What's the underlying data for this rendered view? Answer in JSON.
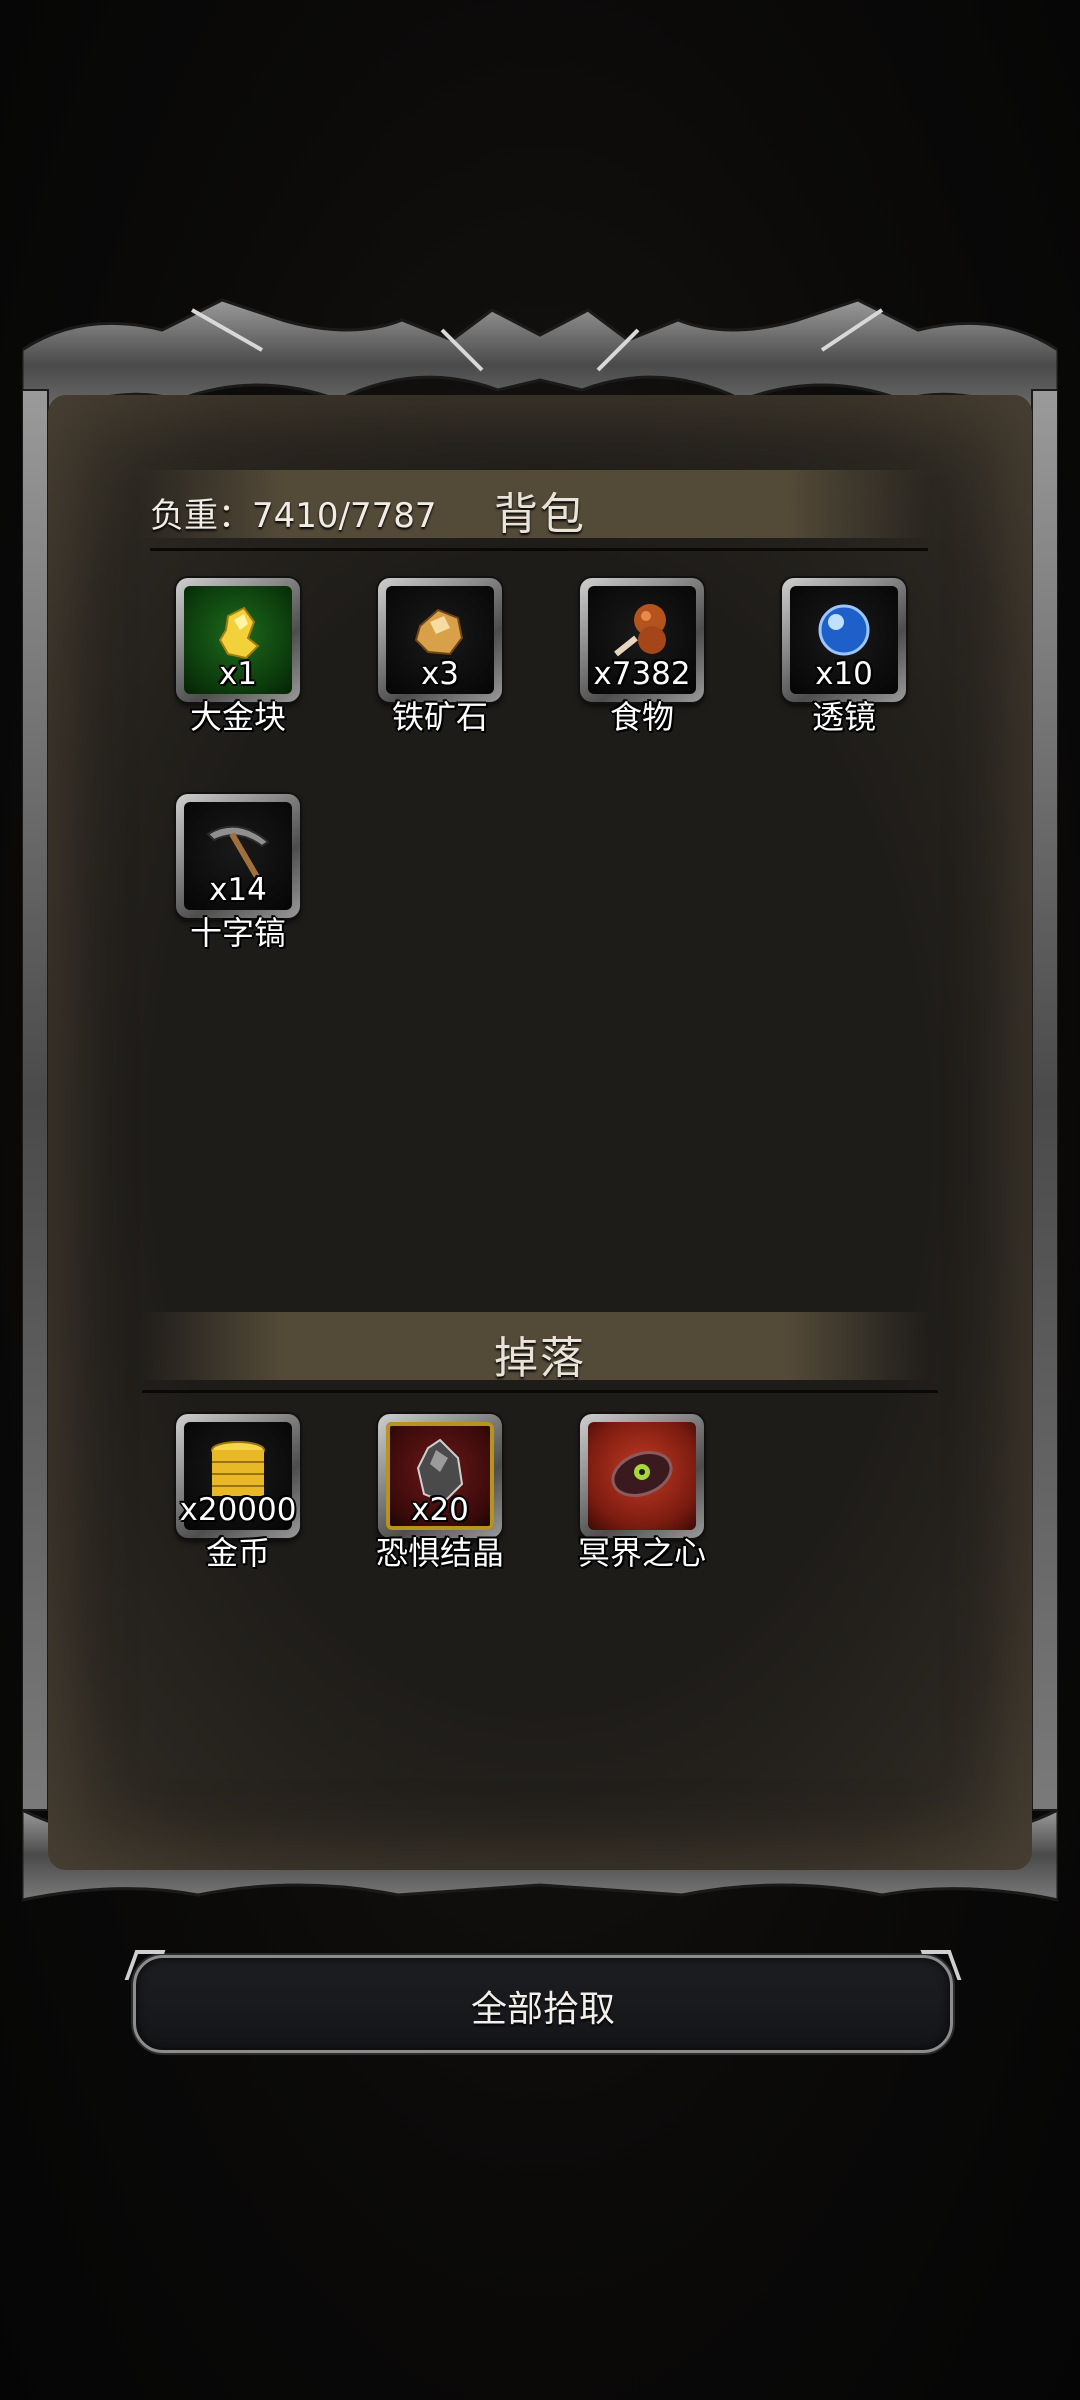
{
  "backpack": {
    "title": "背包",
    "weight_label": "负重：7410/7787",
    "items": [
      {
        "name": "大金块",
        "count": "x1",
        "icon": "gold-nugget-icon"
      },
      {
        "name": "铁矿石",
        "count": "x3",
        "icon": "iron-ore-icon"
      },
      {
        "name": "食物",
        "count": "x7382",
        "icon": "meat-food-icon"
      },
      {
        "name": "透镜",
        "count": "x10",
        "icon": "blue-lens-icon"
      },
      {
        "name": "十字镐",
        "count": "x14",
        "icon": "pickaxe-icon"
      }
    ]
  },
  "drops": {
    "title": "掉落",
    "items": [
      {
        "name": "金币",
        "count": "x20000",
        "icon": "gold-coins-icon"
      },
      {
        "name": "恐惧结晶",
        "count": "x20",
        "icon": "fear-crystal-icon"
      },
      {
        "name": "冥界之心",
        "count": "",
        "icon": "underworld-heart-icon"
      }
    ]
  },
  "actions": {
    "pickup_all_label": "全部拾取"
  }
}
